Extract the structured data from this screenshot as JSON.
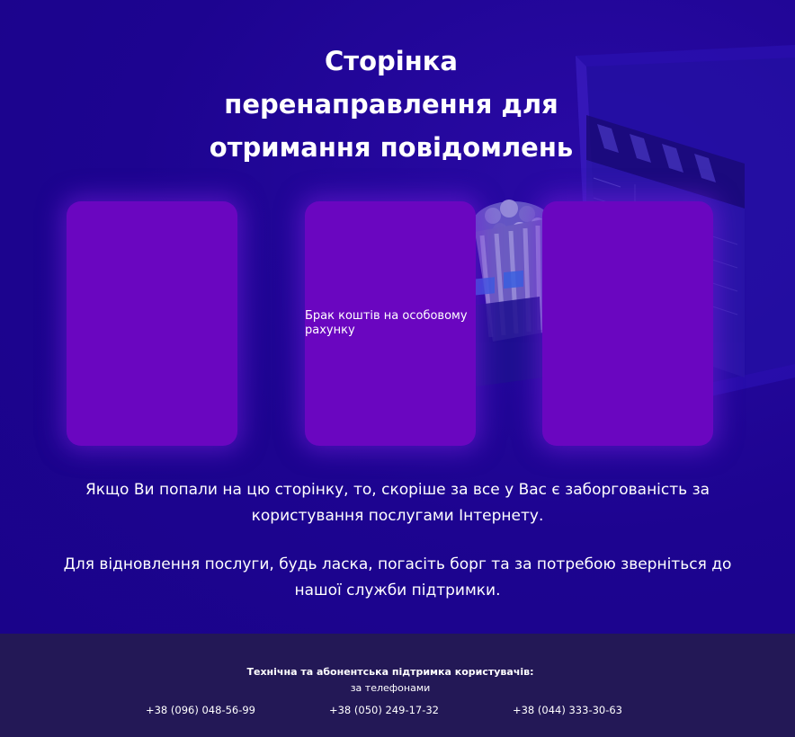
{
  "hero": {
    "title_lines": [
      "Сторінка",
      "перенаправлення для",
      "отримання повідомлень"
    ],
    "cards": [
      {
        "text": ""
      },
      {
        "text": "Брак коштів на особовому рахунку"
      },
      {
        "text": ""
      }
    ],
    "paragraphs": [
      "Якщо Ви попали на цю сторінку, то, скоріше за все у Вас є заборгованість за користування послугами Інтернету.",
      "Для відновлення послуги, будь ласка, погасіть борг та за потребою зверніться до нашої служби підтримки."
    ]
  },
  "footer": {
    "heading": "Технічна та абонентська підтримка користувачів:",
    "subheading": "за телефонами",
    "phones": [
      "+38 (096) 048-56-99",
      "+38 (050) 249-17-32",
      "+38 (044) 333-30-63"
    ]
  },
  "colors": {
    "background": "#1d0490",
    "card": "#6a06c0",
    "footer": "#231856",
    "text": "#ffffff"
  },
  "icons": [
    "clapperboard-illustration",
    "popcorn-illustration",
    "3d-glasses-illustration",
    "screen-illustration"
  ]
}
